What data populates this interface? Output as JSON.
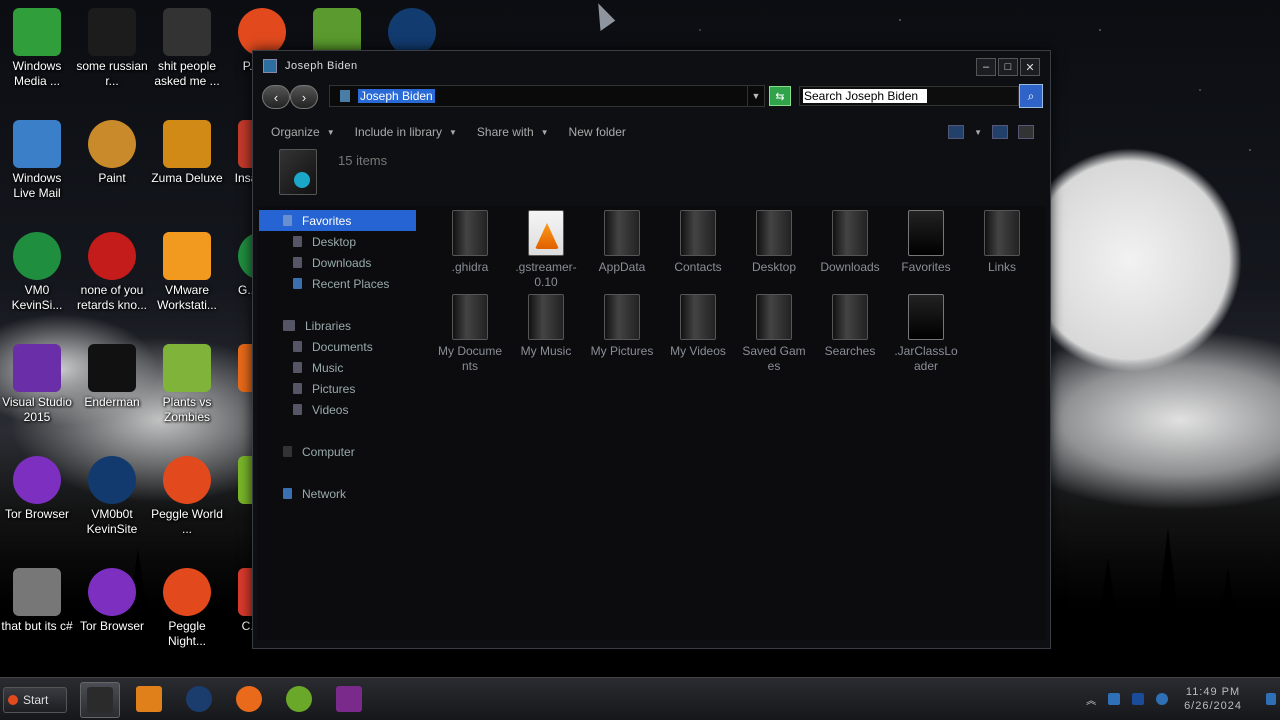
{
  "desktop_icons": [
    {
      "label": "Windows Media ...",
      "icon": "windows-media-icon",
      "color": "#2f9e3b"
    },
    {
      "label": "some russian r...",
      "icon": "after-effects-icon",
      "color": "#1c1c1c"
    },
    {
      "label": "shit people asked me ...",
      "icon": "folder-icon",
      "color": "#333333"
    },
    {
      "label": "P... D...",
      "icon": "peggle-icon",
      "color": "#e24a1e"
    },
    {
      "label": "",
      "icon": "box-game-icon",
      "color": "#5a9a2e"
    },
    {
      "label": "",
      "icon": "globe-icon",
      "color": "#123b70"
    },
    {
      "label": "Windows Live Mail",
      "icon": "mail-icon",
      "color": "#3a7fc8"
    },
    {
      "label": "Paint",
      "icon": "paint-icon",
      "color": "#c88a2a"
    },
    {
      "label": "Zuma Deluxe",
      "icon": "zuma-icon",
      "color": "#d08a15"
    },
    {
      "label": "Insa... D...",
      "icon": "app-icon",
      "color": "#c23a2a"
    },
    {
      "label": "VM0 KevinSi...",
      "icon": "chrome-icon",
      "color": "#1f8e3f"
    },
    {
      "label": "none of you retards kno...",
      "icon": "red-app-icon",
      "color": "#c41b1b"
    },
    {
      "label": "VMware Workstati...",
      "icon": "vmware-icon",
      "color": "#f29a1f"
    },
    {
      "label": "G... Ch...",
      "icon": "chrome-icon",
      "color": "#1f8e3f"
    },
    {
      "label": "Visual Studio 2015",
      "icon": "visual-studio-icon",
      "color": "#6a2fa8"
    },
    {
      "label": "Enderman",
      "icon": "text-file-icon",
      "color": "#111111"
    },
    {
      "label": "Plants vs Zombies",
      "icon": "plants-icon",
      "color": "#7fb33a"
    },
    {
      "label": "F...",
      "icon": "app-icon",
      "color": "#e86a1a"
    },
    {
      "label": "Tor Browser",
      "icon": "tor-icon",
      "color": "#7d2fbf"
    },
    {
      "label": "VM0b0t KevinSite",
      "icon": "monitor-icon",
      "color": "#123a6e"
    },
    {
      "label": "Peggle World ...",
      "icon": "peggle-icon",
      "color": "#e24a1e"
    },
    {
      "label": "C...",
      "icon": "app-icon",
      "color": "#7ab52a"
    },
    {
      "label": "that but its c#",
      "icon": "windows-copy-icon",
      "color": "#777777"
    },
    {
      "label": "Tor Browser",
      "icon": "tor-folder-icon",
      "color": "#7d2fbf"
    },
    {
      "label": "Peggle Night...",
      "icon": "peggle-icon",
      "color": "#e24a1e"
    },
    {
      "label": "C... D...",
      "icon": "app-icon",
      "color": "#d83a2a"
    }
  ],
  "window": {
    "title": "Joseph Biden",
    "controls": {
      "minimize": "–",
      "maximize": "□",
      "close": "✕"
    },
    "address": "Joseph Biden",
    "search_placeholder": "Search Joseph Biden",
    "toolbar": [
      "Organize",
      "Include in library",
      "Share with",
      "New folder"
    ],
    "item_count": "15 items",
    "nav": {
      "favorites": {
        "label": "Favorites",
        "items": [
          "Desktop",
          "Downloads",
          "Recent Places"
        ]
      },
      "libraries": {
        "label": "Libraries",
        "items": [
          "Documents",
          "Music",
          "Pictures",
          "Videos"
        ]
      },
      "computer": "Computer",
      "network": "Network"
    },
    "files": [
      {
        "name": ".ghidra",
        "type": "folder"
      },
      {
        "name": ".gstreamer-0.10",
        "type": "cone"
      },
      {
        "name": "AppData",
        "type": "folder"
      },
      {
        "name": "Contacts",
        "type": "folder"
      },
      {
        "name": "Desktop",
        "type": "folder"
      },
      {
        "name": "Downloads",
        "type": "folder"
      },
      {
        "name": "Favorites",
        "type": "dark"
      },
      {
        "name": "Links",
        "type": "folder"
      },
      {
        "name": "My Documents",
        "type": "folder"
      },
      {
        "name": "My Music",
        "type": "folder"
      },
      {
        "name": "My Pictures",
        "type": "folder"
      },
      {
        "name": "My Videos",
        "type": "folder"
      },
      {
        "name": "Saved Games",
        "type": "folder"
      },
      {
        "name": "Searches",
        "type": "folder"
      },
      {
        "name": ".JarClassLoader",
        "type": "dark"
      }
    ]
  },
  "taskbar": {
    "start_label": "Start",
    "apps": [
      {
        "name": "explorer-icon",
        "color": "#2b2b2b",
        "active": true
      },
      {
        "name": "media-player-icon",
        "color": "#e0801a",
        "active": false
      },
      {
        "name": "globe-icon",
        "color": "#1b3d6e",
        "active": false
      },
      {
        "name": "firefox-icon",
        "color": "#e86a1a",
        "active": false
      },
      {
        "name": "browser-green-icon",
        "color": "#6aa82a",
        "active": false
      },
      {
        "name": "winrar-icon",
        "color": "#7a2a8a",
        "active": false
      }
    ],
    "clock_time": "11:49 PM",
    "clock_date": "6/26/2024"
  }
}
